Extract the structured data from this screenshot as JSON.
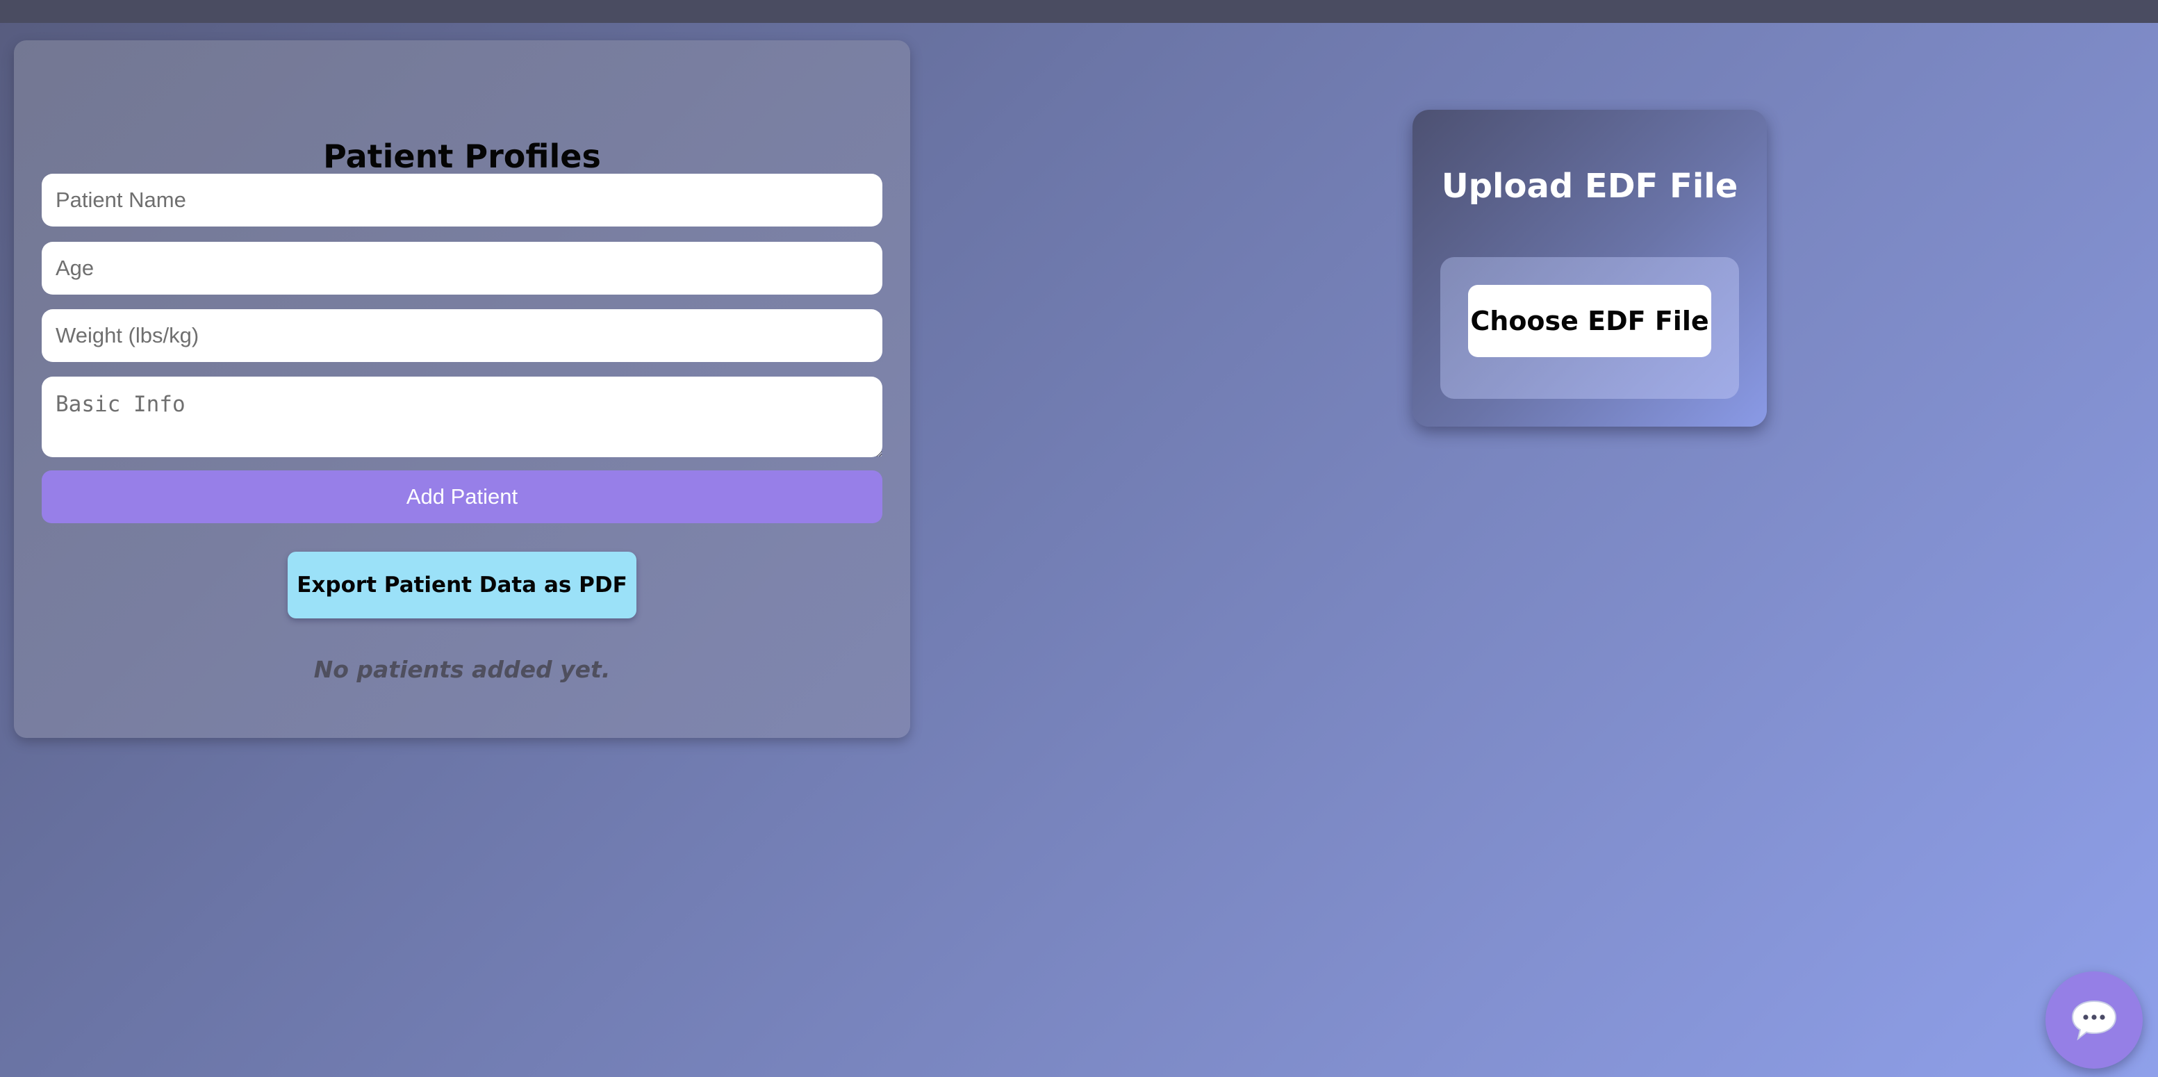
{
  "profiles": {
    "title": "Patient Profiles",
    "name_placeholder": "Patient Name",
    "age_placeholder": "Age",
    "weight_placeholder": "Weight (lbs/kg)",
    "info_placeholder": "Basic Info",
    "add_label": "Add Patient",
    "export_label": "Export Patient Data as PDF",
    "empty_message": "No patients added yet."
  },
  "upload": {
    "title": "Upload EDF File",
    "choose_label": "Choose EDF File"
  },
  "chat": {
    "icon": "chat-bubble-icon"
  },
  "colors": {
    "primary_button": "#977fe8",
    "export_button": "#9be1f8",
    "chat_button": "#957fe6"
  }
}
